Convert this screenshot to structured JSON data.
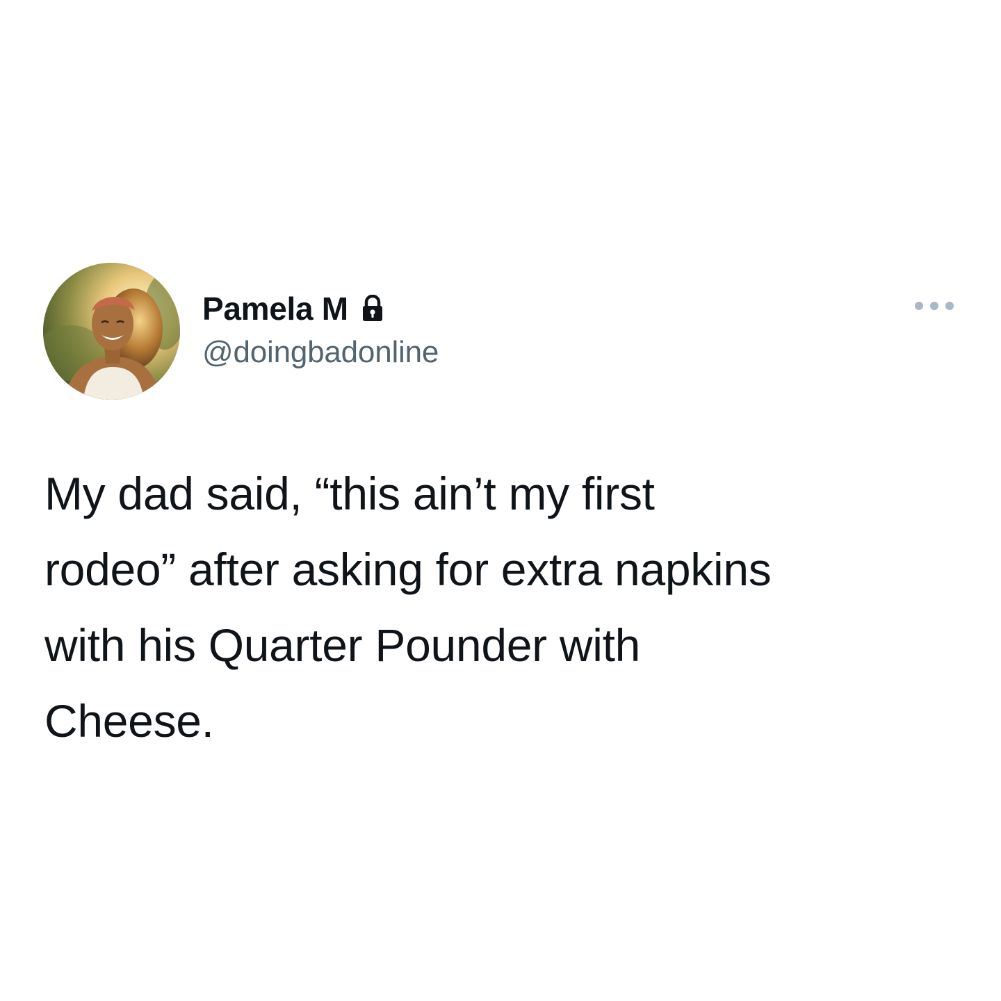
{
  "tweet": {
    "author": {
      "display_name": "Pamela M",
      "handle": "@doingbadonline",
      "avatar_icon": "profile-photo-smiling-woman",
      "protected_icon": "lock-icon"
    },
    "more_icon": "more-options-dots-icon",
    "text_lines": [
      "My dad said, “this ain’t my first",
      "rodeo” after asking for extra napkins",
      "with his Quarter Pounder with",
      "Cheese."
    ]
  },
  "colors": {
    "background": "#ffffff",
    "primary_text": "#0f1419",
    "secondary_text": "#536471",
    "icon_muted": "#aab8c2"
  }
}
